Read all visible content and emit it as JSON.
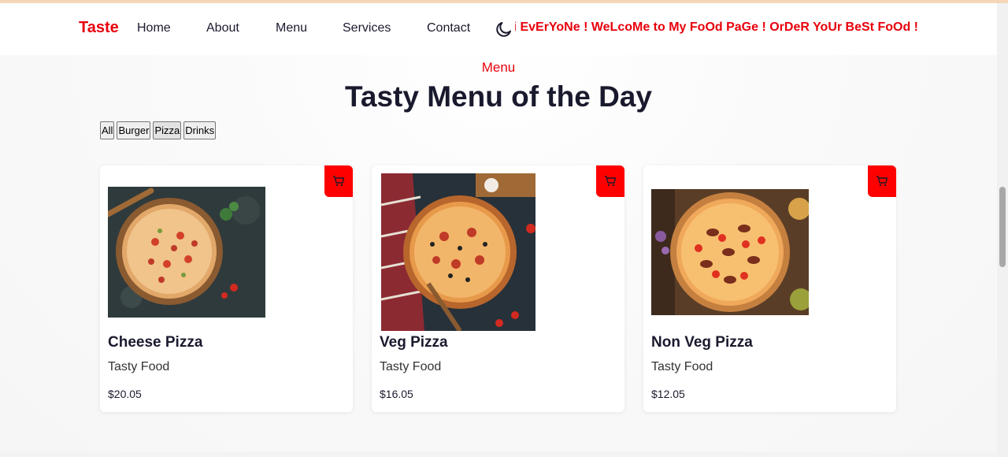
{
  "nav": {
    "logo": "Taste",
    "links": [
      "Home",
      "About",
      "Menu",
      "Services",
      "Contact"
    ],
    "theme_icon": "moon-icon",
    "marquee": "Hi EvErYoNe ! WeLcoMe to My FoOd PaGe ! OrDeR YoUr BeSt FoOd !"
  },
  "menu": {
    "subtitle": "Menu",
    "title": "Tasty Menu of the Day",
    "filters": [
      "All",
      "Burger",
      "Pizza",
      "Drinks"
    ],
    "active_filter": "Pizza",
    "items": [
      {
        "name": "Cheese Pizza",
        "description": "Tasty Food",
        "price": "$20.05",
        "image": "cheese-pizza-photo"
      },
      {
        "name": "Veg Pizza",
        "description": "Tasty Food",
        "price": "$16.05",
        "image": "veg-pizza-photo"
      },
      {
        "name": "Non Veg Pizza",
        "description": "Tasty Food",
        "price": "$12.05",
        "image": "non-veg-pizza-photo"
      }
    ]
  },
  "colors": {
    "accent": "#e8000b",
    "cart_button": "#ff0000",
    "text": "#1a1a2e"
  }
}
